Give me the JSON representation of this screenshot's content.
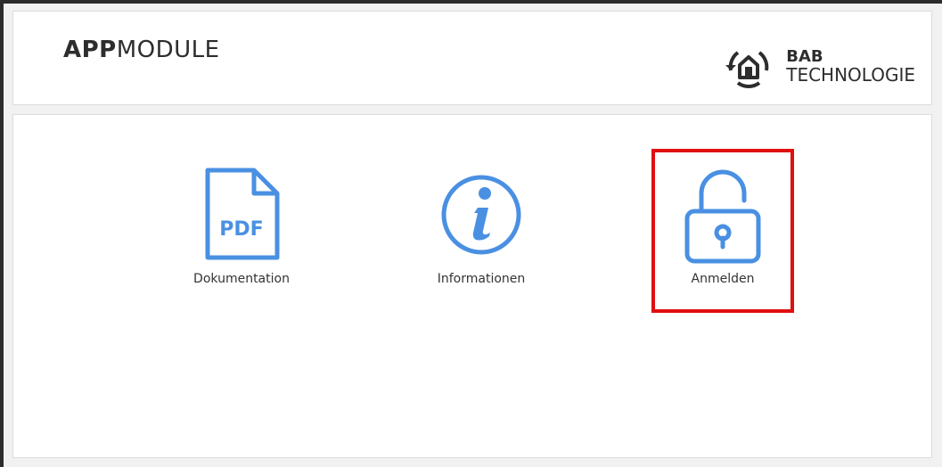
{
  "header": {
    "title_bold": "APP",
    "title_light": "MODULE",
    "logo": {
      "line1": "BAB",
      "line2": "TECHNOLOGIE",
      "icon": "house-logo-icon"
    }
  },
  "tiles": [
    {
      "label": "Dokumentation",
      "icon": "pdf-document-icon",
      "icon_text": "PDF"
    },
    {
      "label": "Informationen",
      "icon": "info-icon"
    },
    {
      "label": "Anmelden",
      "icon": "unlocked-padlock-icon",
      "highlighted": true
    }
  ],
  "colors": {
    "accent": "#4a90e2",
    "highlight": "#e01010",
    "text": "#333333"
  }
}
